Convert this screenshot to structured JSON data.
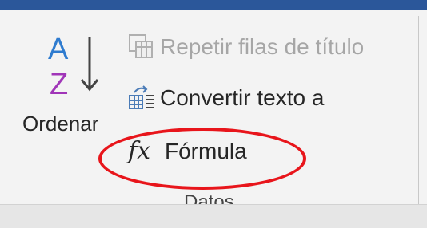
{
  "group": {
    "label": "Datos"
  },
  "sort": {
    "label": "Ordenar",
    "icon": "sort-az-icon",
    "letter_a": "A",
    "letter_z": "Z",
    "color_a": "#2e7bcf",
    "color_z": "#a035b8"
  },
  "commands": {
    "repeat": {
      "label": "Repetir filas de título",
      "enabled": false,
      "icon": "repeat-header-rows-icon"
    },
    "convert": {
      "label": "Convertir texto a",
      "enabled": true,
      "icon": "convert-to-text-icon"
    },
    "formula": {
      "label": "Fórmula",
      "enabled": true,
      "icon": "fx-icon",
      "glyph": "fx"
    }
  },
  "annotation": {
    "type": "red-ellipse-highlight",
    "target": "formula-button",
    "color": "#e8151b"
  },
  "colors": {
    "ribbon_bg": "#f3f3f3",
    "title_bar": "#2b579a",
    "text": "#262626",
    "disabled_text": "#a6a6a6"
  }
}
